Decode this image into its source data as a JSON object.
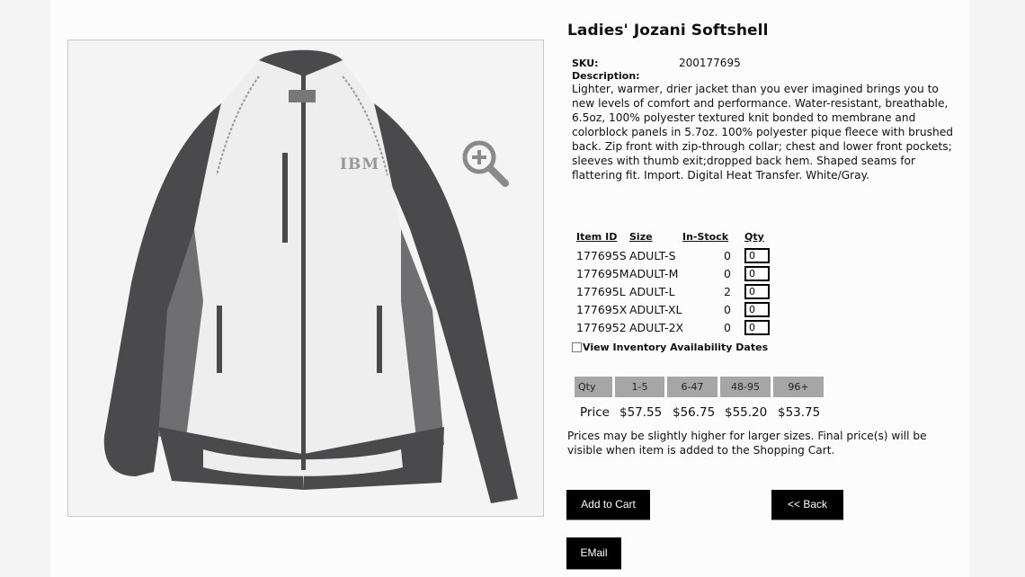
{
  "product": {
    "title": "Ladies' Jozani Softshell",
    "sku_label": "SKU:",
    "sku_value": "200177695",
    "description_label": "Description:",
    "description": "Lighter, warmer, drier jacket than you ever imagined brings you to new levels of comfort and performance. Water-resistant, breathable, 6.5oz, 100% polyester textured knit bonded to membrane and colorblock panels in 5.7oz. 100% polyester pique fleece with brushed back. Zip front with zip-through collar; chest and lower front pockets; sleeves with thumb exit;dropped back hem. Shaped seams for flattering fit. Import. Digital Heat Transfer. White/Gray.",
    "logo_text": "IBM"
  },
  "inventory": {
    "headers": {
      "item_id": "Item ID",
      "size": "Size",
      "in_stock": "In-Stock",
      "qty": "Qty"
    },
    "rows": [
      {
        "item_id": "177695S",
        "size": "ADULT-S",
        "in_stock": "0",
        "qty": "0"
      },
      {
        "item_id": "177695M",
        "size": "ADULT-M",
        "in_stock": "0",
        "qty": "0"
      },
      {
        "item_id": "177695L",
        "size": "ADULT-L",
        "in_stock": "2",
        "qty": "0"
      },
      {
        "item_id": "177695X",
        "size": "ADULT-XL",
        "in_stock": "0",
        "qty": "0"
      },
      {
        "item_id": "1776952",
        "size": "ADULT-2X",
        "in_stock": "0",
        "qty": "0"
      }
    ],
    "availability_label": "View Inventory Availability Dates"
  },
  "pricing": {
    "qty_label": "Qty",
    "tiers": [
      "1-5",
      "6-47",
      "48-95",
      "96+"
    ],
    "price_label": "Price",
    "prices": [
      "$57.55",
      "$56.75",
      "$55.20",
      "$53.75"
    ],
    "note": "Prices may be slightly higher for larger sizes. Final price(s) will be visible when item is added to the Shopping Cart."
  },
  "actions": {
    "add_to_cart": "Add to Cart",
    "back": "<< Back",
    "email": "EMail"
  },
  "colors": {
    "jacket_white": "#eeeeee",
    "jacket_charcoal": "#4a4a4c",
    "jacket_gray": "#6f6f72",
    "button_bg": "#000000",
    "tier_bg": "#a6a6a6"
  },
  "icons": {
    "zoom": "zoom-in-icon"
  }
}
